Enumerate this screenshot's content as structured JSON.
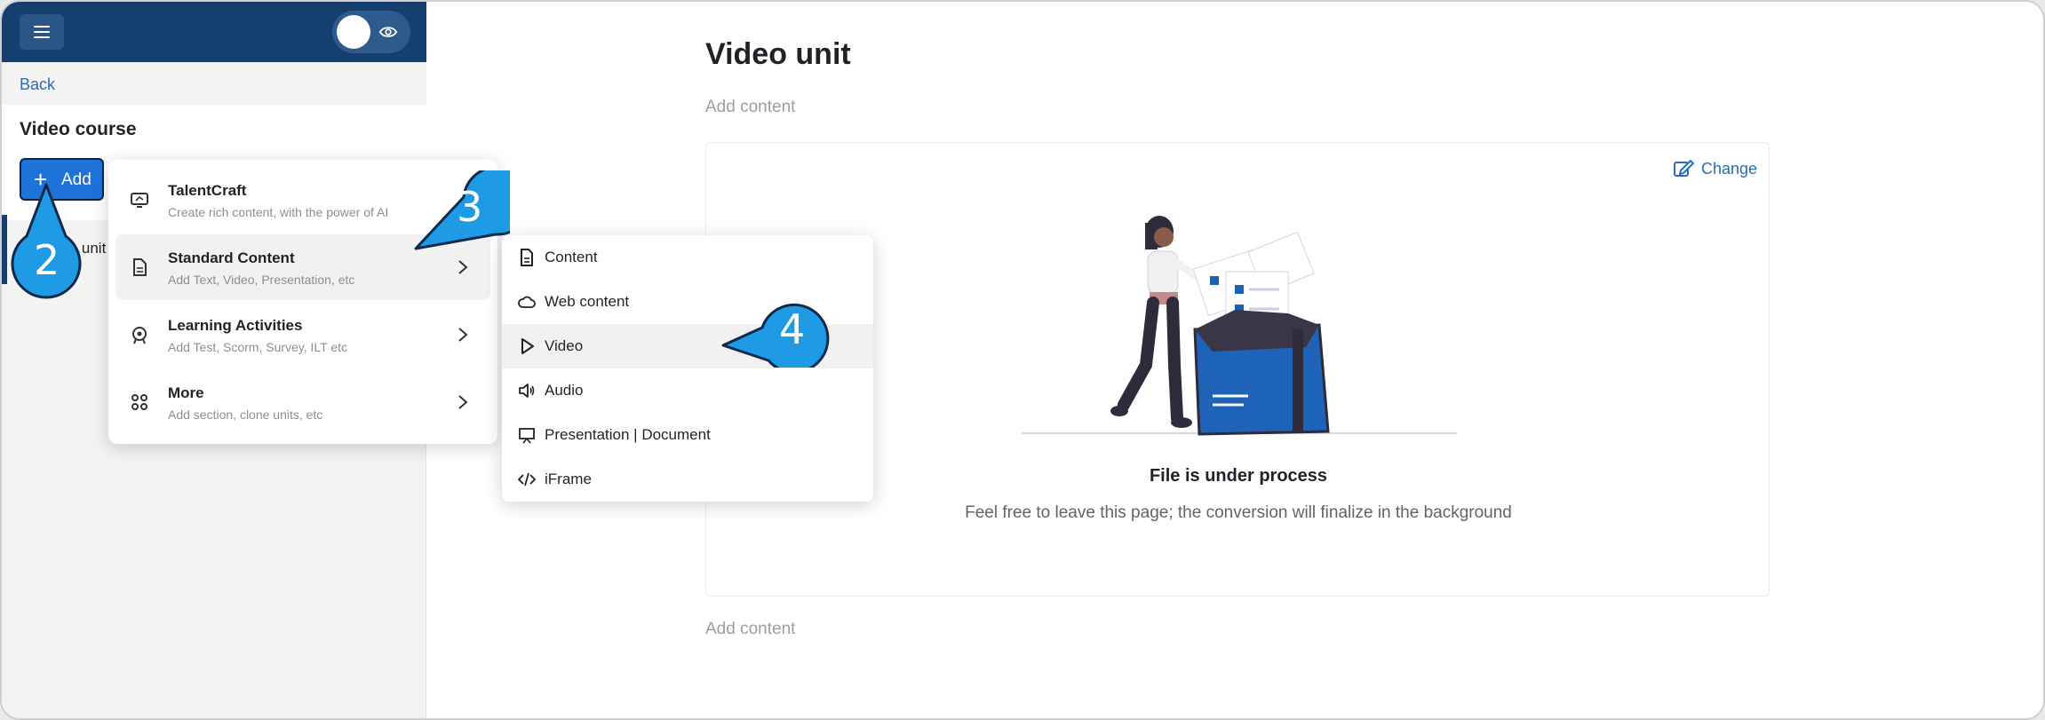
{
  "sidebar": {
    "back_label": "Back",
    "course_title": "Video course",
    "add_button_label": "Add",
    "unit_label": "Video unit"
  },
  "main": {
    "title": "Video unit",
    "add_content_top": "Add content",
    "add_content_bottom": "Add content",
    "change_label": "Change",
    "processing_title": "File is under process",
    "processing_desc": "Feel free to leave this page; the conversion will finalize in the background"
  },
  "add_menu": {
    "items": [
      {
        "title": "TalentCraft",
        "subtitle": "Create rich content, with the power of AI",
        "icon": "ai-content-icon"
      },
      {
        "title": "Standard Content",
        "subtitle": "Add Text, Video, Presentation, etc",
        "icon": "document-icon"
      },
      {
        "title": "Learning Activities",
        "subtitle": "Add Test, Scorm, Survey, ILT etc",
        "icon": "activities-icon"
      },
      {
        "title": "More",
        "subtitle": "Add section, clone units, etc",
        "icon": "grid-icon"
      }
    ]
  },
  "standard_submenu": {
    "items": [
      {
        "label": "Content",
        "icon": "file-icon"
      },
      {
        "label": "Web content",
        "icon": "cloud-icon"
      },
      {
        "label": "Video",
        "icon": "play-icon"
      },
      {
        "label": "Audio",
        "icon": "speaker-icon"
      },
      {
        "label": "Presentation | Document",
        "icon": "presentation-icon"
      },
      {
        "label": "iFrame",
        "icon": "code-icon"
      }
    ]
  },
  "callouts": [
    "2",
    "3",
    "4"
  ],
  "colors": {
    "header_bg": "#153f6e",
    "accent": "#1e73d9",
    "callout": "#1e9be4",
    "link": "#2a6db5"
  }
}
